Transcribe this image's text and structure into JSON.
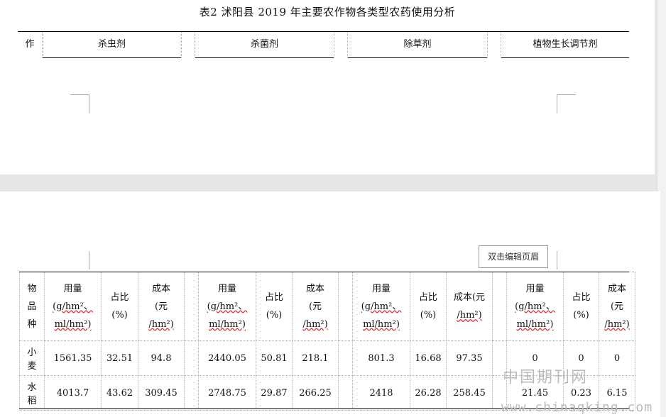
{
  "title": "表2  沭阳县 2019 年主要农作物各类型农药使用分析",
  "top_header": {
    "first_col": "作",
    "groups": [
      "杀虫剂",
      "杀菌剂",
      "除草剂",
      "植物生长调节剂"
    ]
  },
  "header_button": "双击编辑页眉",
  "table": {
    "crop_header": [
      "物",
      "品",
      "种"
    ],
    "groups": [
      {
        "usage": [
          "用量",
          "(g/hm²、",
          "ml/hm²)"
        ],
        "share": [
          "占比",
          "(%)"
        ],
        "cost": [
          "成本",
          "(元",
          "/hm²)"
        ]
      },
      {
        "usage": [
          "用量",
          "(g/hm²、",
          "ml/hm²)"
        ],
        "share": [
          "占比",
          "(%)"
        ],
        "cost": [
          "成本",
          "(元",
          "/hm²)"
        ]
      },
      {
        "usage": [
          "用量",
          "(g/hm²、",
          "ml/hm²)"
        ],
        "share": [
          "占比",
          "(%)"
        ],
        "cost": [
          "成本(元",
          "/hm²)"
        ]
      },
      {
        "usage": [
          "用量",
          "(g/hm²、",
          "ml/hm²)"
        ],
        "share": [
          "占比",
          "(%)"
        ],
        "cost": [
          "成本",
          "(元",
          "/hm²)"
        ]
      }
    ],
    "rows": [
      {
        "crop": [
          "小",
          "麦"
        ],
        "values": [
          "1561.35",
          "32.51",
          "94.8",
          "2440.05",
          "50.81",
          "218.1",
          "801.3",
          "16.68",
          "97.35",
          "0",
          "0",
          "0"
        ]
      },
      {
        "crop": [
          "水",
          "稻"
        ],
        "values": [
          "4013.7",
          "43.62",
          "309.45",
          "2748.75",
          "29.87",
          "266.25",
          "2418",
          "26.28",
          "258.45",
          "21.45",
          "0.23",
          "6.15"
        ]
      }
    ]
  },
  "watermark": {
    "cn": "中国期刊网",
    "url": "www.chinaqking.com"
  }
}
